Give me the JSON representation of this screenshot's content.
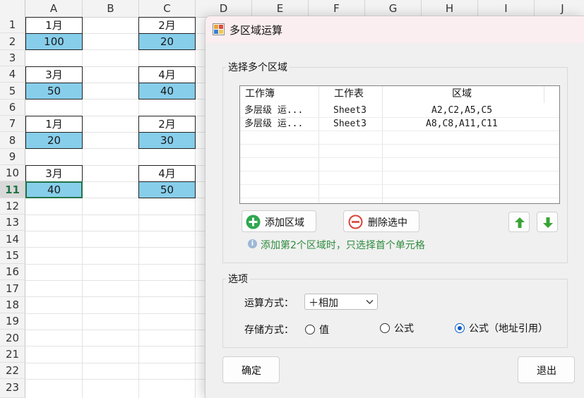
{
  "sheet": {
    "columns": [
      "A",
      "B",
      "C",
      "D",
      "E",
      "F",
      "G",
      "H",
      "I",
      "J"
    ],
    "rows": [
      "1",
      "2",
      "3",
      "4",
      "5",
      "6",
      "7",
      "8",
      "9",
      "10",
      "11",
      "12",
      "13",
      "14",
      "15",
      "16",
      "17",
      "18",
      "19",
      "20",
      "21",
      "22",
      "23"
    ],
    "cells": {
      "A1": "1月",
      "A2": "100",
      "C1": "2月",
      "C2": "20",
      "A4": "3月",
      "A5": "50",
      "C4": "4月",
      "C5": "40",
      "A7": "1月",
      "A8": "20",
      "C7": "2月",
      "C8": "30",
      "A10": "3月",
      "A11": "40",
      "C10": "4月",
      "C11": "50"
    },
    "value_fill_color": "#87ceeb",
    "selected_row": "11"
  },
  "dialog": {
    "title": "多区域运算",
    "icon": "app-grid-icon",
    "ranges_group_title": "选择多个区域",
    "list_headers": [
      "工作簿",
      "工作表",
      "区域"
    ],
    "list_rows": [
      {
        "workbook": "多层级 运...",
        "sheet": "Sheet3",
        "range": "A2,C2,A5,C5"
      },
      {
        "workbook": "多层级 运...",
        "sheet": "Sheet3",
        "range": "A8,C8,A11,C11"
      }
    ],
    "add_range_label": "添加区域",
    "delete_selected_label": "删除选中",
    "move_up_icon": "arrow-up-icon",
    "move_down_icon": "arrow-down-icon",
    "hint_text": "添加第2个区域时，只选择首个单元格",
    "options_group_title": "选项",
    "operation_label": "运算方式：",
    "operation_value": "＋相加",
    "storage_label": "存储方式：",
    "storage_options": [
      "值",
      "公式",
      "公式（地址引用）"
    ],
    "storage_selected": "公式（地址引用）",
    "ok_label": "确定",
    "exit_label": "退出"
  }
}
